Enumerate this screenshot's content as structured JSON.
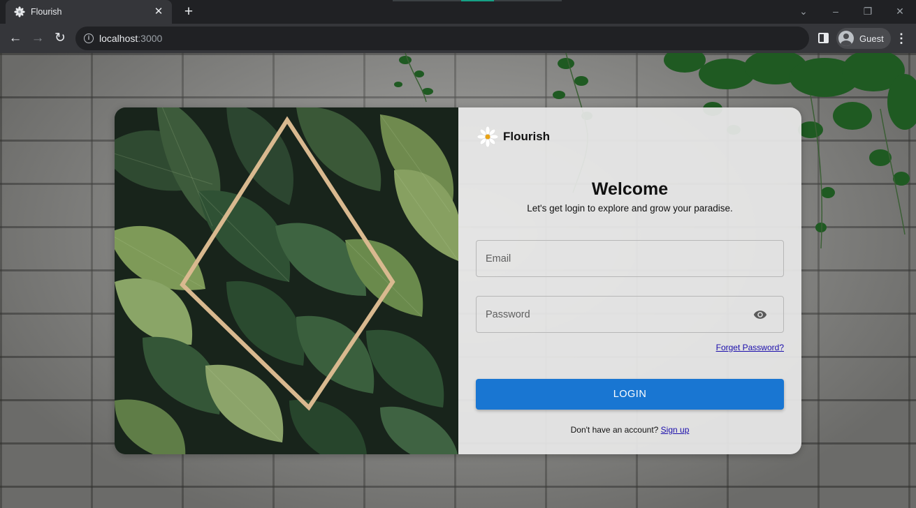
{
  "browser": {
    "tab_title": "Flourish",
    "new_tab_icon": "plus-icon",
    "url_host": "localhost",
    "url_port": ":3000",
    "profile_name": "Guest"
  },
  "page": {
    "brand_name": "Flourish",
    "welcome_title": "Welcome",
    "subtitle": "Let's get login to explore and grow your paradise.",
    "email_placeholder": "Email",
    "password_placeholder": "Password",
    "forgot_password": "Forget Password?",
    "login_button": "LOGIN",
    "signup_prompt": "Don't have an account?",
    "signup_link": "Sign up"
  },
  "colors": {
    "primary": "#1976d2",
    "link": "#1a0dab",
    "chrome_dark": "#202124",
    "chrome_toolbar": "#35363a"
  }
}
